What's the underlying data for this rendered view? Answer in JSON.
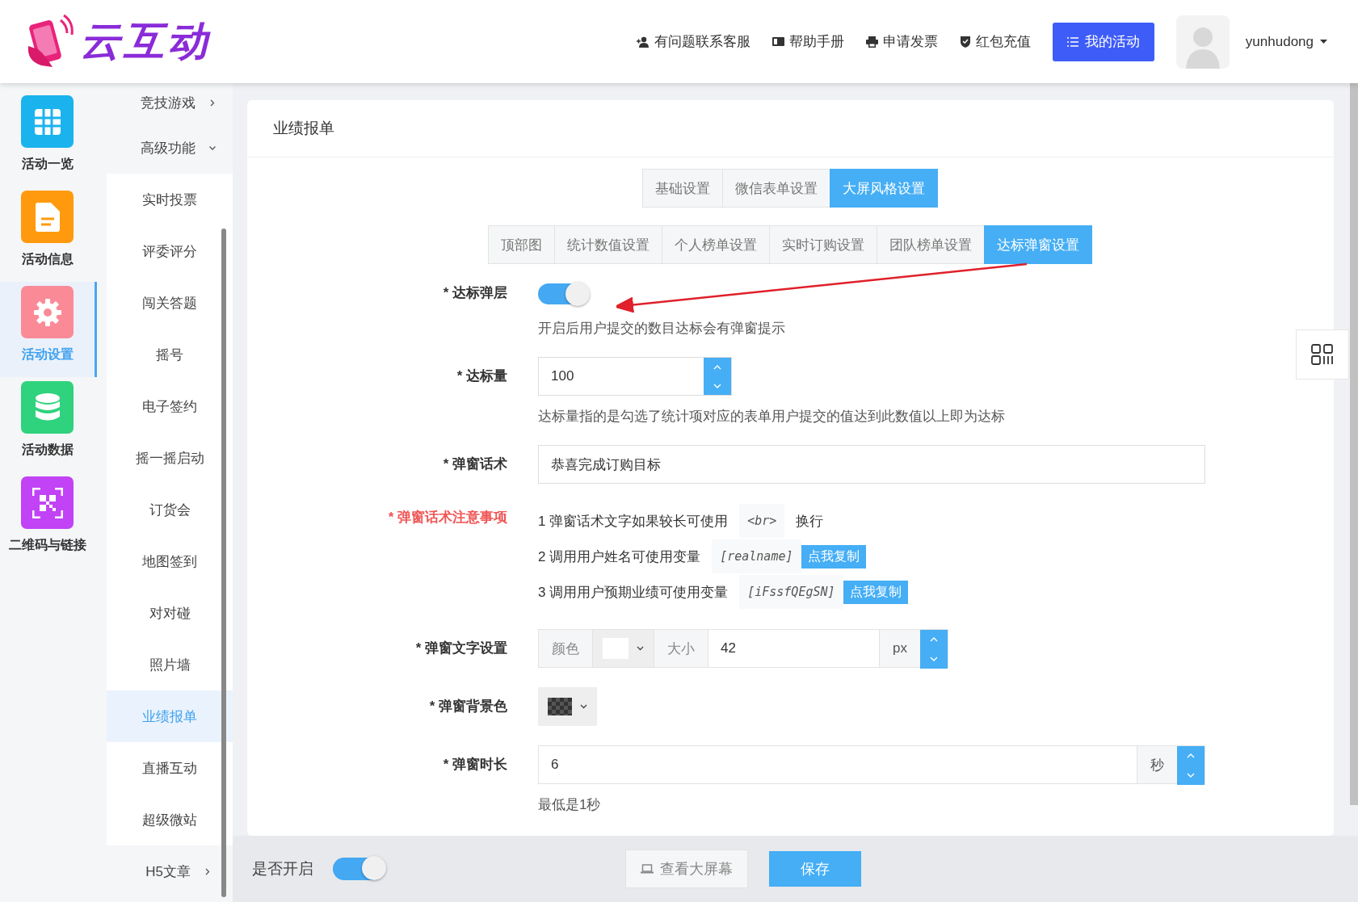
{
  "header": {
    "logo": "云互动",
    "nav": [
      {
        "kind": "person",
        "label": "有问题联系客服"
      },
      {
        "kind": "book",
        "label": "帮助手册"
      },
      {
        "kind": "printer",
        "label": "申请发票"
      },
      {
        "kind": "shield",
        "label": "红包充值"
      }
    ],
    "primary_button": "我的活动",
    "username": "yunhudong"
  },
  "icon_sidebar": [
    {
      "kind": "grid",
      "label": "活动一览",
      "color": "#1ab3ee",
      "selected": false
    },
    {
      "kind": "doc",
      "label": "活动信息",
      "color": "#ff9a0e",
      "selected": false
    },
    {
      "kind": "gear",
      "label": "活动设置",
      "color": "#fb8a97",
      "selected": true
    },
    {
      "kind": "db",
      "label": "活动数据",
      "color": "#2fd27d",
      "selected": false
    },
    {
      "kind": "qr",
      "label": "二维码与链接",
      "color": "#c143f5",
      "selected": false
    }
  ],
  "submenu": [
    {
      "label": "竞技游戏",
      "expanded": false
    },
    {
      "label": "高级功能",
      "expanded": true,
      "children": [
        {
          "label": "实时投票",
          "selected": false
        },
        {
          "label": "评委评分",
          "selected": false
        },
        {
          "label": "闯关答题",
          "selected": false
        },
        {
          "label": "摇号",
          "selected": false
        },
        {
          "label": "电子签约",
          "selected": false
        },
        {
          "label": "摇一摇启动",
          "selected": false
        },
        {
          "label": "订货会",
          "selected": false
        },
        {
          "label": "地图签到",
          "selected": false
        },
        {
          "label": "对对碰",
          "selected": false
        },
        {
          "label": "照片墙",
          "selected": false
        },
        {
          "label": "业绩报单",
          "selected": true
        },
        {
          "label": "直播互动",
          "selected": false
        },
        {
          "label": "超级微站",
          "selected": false
        }
      ]
    },
    {
      "label": "H5文章",
      "expanded": false
    }
  ],
  "card_title": "业绩报单",
  "tabs": [
    {
      "label": "基础设置",
      "selected": false
    },
    {
      "label": "微信表单设置",
      "selected": false
    },
    {
      "label": "大屏风格设置",
      "selected": true
    }
  ],
  "subtabs": [
    {
      "label": "顶部图",
      "selected": false
    },
    {
      "label": "统计数值设置",
      "selected": false
    },
    {
      "label": "个人榜单设置",
      "selected": false
    },
    {
      "label": "实时订购设置",
      "selected": false
    },
    {
      "label": "团队榜单设置",
      "selected": false
    },
    {
      "label": "达标弹窗设置",
      "selected": true
    }
  ],
  "fields": [
    {
      "kind": "toggle",
      "label": "* 达标弹层",
      "on": true,
      "hint": "开启后用户提交的数目达标会有弹窗提示"
    },
    {
      "kind": "number",
      "label": "* 达标量",
      "value": "100",
      "hint": "达标量指的是勾选了统计项对应的表单用户提交的值达到此数值以上即为达标"
    },
    {
      "kind": "text",
      "label": "* 弹窗话术",
      "value": "恭喜完成订购目标"
    },
    {
      "kind": "notes",
      "label": "* 弹窗话术注意事项",
      "notes": [
        {
          "text": "1 弹窗话术文字如果较长可使用",
          "code": "<br>",
          "after": "换行"
        },
        {
          "text": "2 调用用户姓名可使用变量",
          "code": "[realname]",
          "button": "点我复制"
        },
        {
          "text": "3 调用用户预期业绩可使用变量",
          "code": "[iFssfQEgSN]",
          "button": "点我复制"
        }
      ]
    },
    {
      "kind": "text_style",
      "label": "* 弹窗文字设置",
      "color_label": "颜色",
      "size_label": "大小",
      "value": "42",
      "unit": "px"
    },
    {
      "kind": "color",
      "label": "* 弹窗背景色"
    },
    {
      "kind": "number_unit",
      "label": "* 弹窗时长",
      "value": "6",
      "unit": "秒",
      "hint": "最低是1秒"
    }
  ],
  "footer": {
    "switch_label": "是否开启",
    "on": true,
    "preview_button": "查看大屏幕",
    "save_button": "保存"
  }
}
